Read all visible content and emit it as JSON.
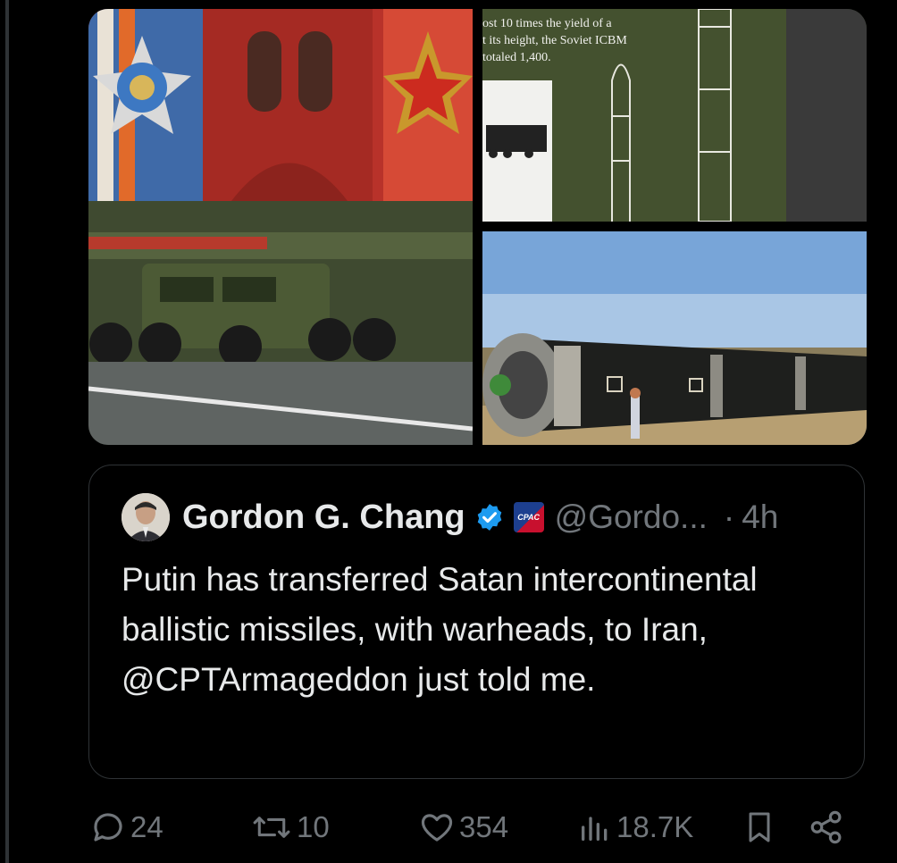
{
  "media": {
    "images": [
      {
        "icon": "military-parade-image"
      },
      {
        "icon": "icbm-museum-exhibit-image",
        "caption_lines": [
          "ost 10 times the yield of a",
          "t its height, the Soviet ICBM",
          "totaled 1,400."
        ]
      },
      {
        "icon": "satan-missile-image"
      }
    ]
  },
  "quote": {
    "author_name": "Gordon G. Chang",
    "handle": "@Gordo...",
    "separator": "·",
    "time": "4h",
    "badge_text": "CPAC",
    "text": "Putin has transferred Satan intercontinental ballistic missiles, with warheads, to Iran, @CPTArmageddon just told me."
  },
  "actions": {
    "replies": "24",
    "reposts": "10",
    "likes": "354",
    "views": "18.7K"
  },
  "colors": {
    "background": "#000000",
    "text": "#e7e9ea",
    "muted": "#71767b",
    "border": "#2f3336",
    "verified": "#1d9bf0"
  }
}
